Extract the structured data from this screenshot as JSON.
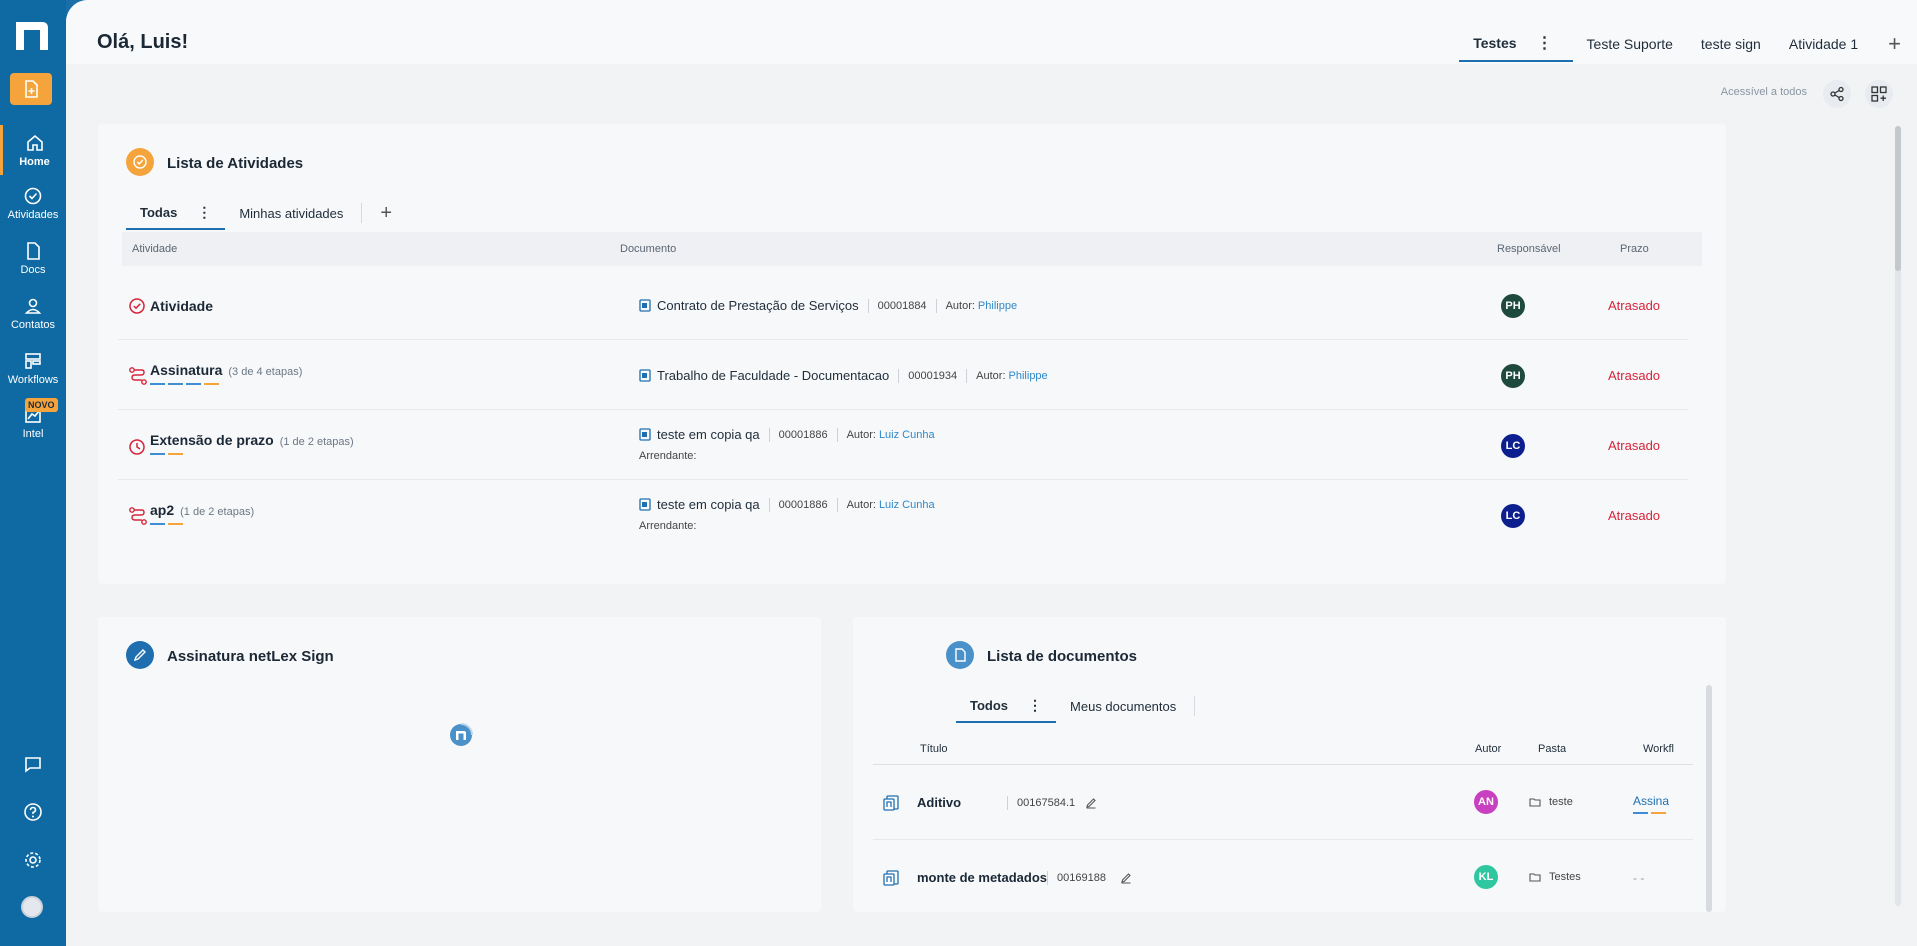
{
  "sidebar": {
    "items": [
      {
        "label": "Home",
        "icon": "home-icon"
      },
      {
        "label": "Atividades",
        "icon": "check-circle-icon"
      },
      {
        "label": "Docs",
        "icon": "document-icon"
      },
      {
        "label": "Contatos",
        "icon": "user-icon"
      },
      {
        "label": "Workflows",
        "icon": "workflow-icon"
      },
      {
        "label": "Intel",
        "icon": "chart-icon"
      }
    ],
    "novo_badge": "NOVO",
    "bottom_icons": [
      "chat-icon",
      "help-icon",
      "settings-icon",
      "avatar"
    ]
  },
  "header": {
    "greeting": "Olá, Luis!",
    "tabs": [
      "Testes",
      "Teste Suporte",
      "teste sign",
      "Atividade 1"
    ],
    "tab_menu": "⋮",
    "add_tab": "+",
    "access_text": "Acessível a todos"
  },
  "activities": {
    "title": "Lista de Atividades",
    "tabs": [
      "Todas",
      "Minhas atividades"
    ],
    "tab_menu": "⋮",
    "add_tab": "+",
    "columns": {
      "activity": "Atividade",
      "document": "Documento",
      "responsible": "Responsável",
      "deadline": "Prazo"
    },
    "rows": [
      {
        "name": "Atividade",
        "steps": "",
        "doc": "Contrato de Prestação de Serviços",
        "code": "00001884",
        "author_label": "Autor:",
        "author": "Philippe",
        "arrendante": "",
        "resp": "PH",
        "status": "Atrasado"
      },
      {
        "name": "Assinatura",
        "steps": "(3 de 4 etapas)",
        "doc": "Trabalho de Faculdade - Documentacao",
        "code": "00001934",
        "author_label": "Autor:",
        "author": "Philippe",
        "arrendante": "",
        "resp": "PH",
        "status": "Atrasado"
      },
      {
        "name": "Extensão de prazo",
        "steps": "(1 de 2 etapas)",
        "doc": "teste em copia qa",
        "code": "00001886",
        "author_label": "Autor:",
        "author": "Luiz Cunha",
        "arrendante": "Arrendante:",
        "resp": "LC",
        "status": "Atrasado"
      },
      {
        "name": "ap2",
        "steps": "(1 de 2 etapas)",
        "doc": "teste em copia qa",
        "code": "00001886",
        "author_label": "Autor:",
        "author": "Luiz Cunha",
        "arrendante": "Arrendante:",
        "resp": "LC",
        "status": "Atrasado"
      }
    ],
    "colors": {
      "overdue": "#d6243a",
      "ph": "#1d4a3c",
      "lc": "#0d1f8f"
    }
  },
  "sign": {
    "title": "Assinatura netLex Sign"
  },
  "documents": {
    "title": "Lista de documentos",
    "tabs": [
      "Todos",
      "Meus documentos"
    ],
    "tab_menu": "⋮",
    "columns": {
      "title": "Título",
      "author": "Autor",
      "folder": "Pasta",
      "workflow": "Workfl"
    },
    "rows": [
      {
        "name": "Aditivo",
        "code": "00167584.1",
        "author": "AN",
        "author_color": "#c83fc0",
        "folder": "teste",
        "workflow": "Assina"
      },
      {
        "name": "monte de metadados",
        "code": "00169188",
        "author": "KL",
        "author_color": "#2ec7a0",
        "folder": "Testes",
        "workflow": "- -"
      }
    ]
  }
}
